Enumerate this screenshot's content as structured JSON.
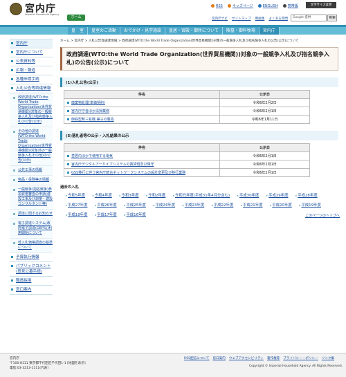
{
  "header": {
    "site_title": "宮内庁",
    "site_subtitle": "Imperial Household Agency",
    "home": "ホーム",
    "top_links": [
      "RSS",
      "キッズページ",
      "ENGLISH",
      "携帯版"
    ],
    "size_button": "文字サイズ変更",
    "sub_links": [
      "宮内庁ナビ",
      "サイトマップ",
      "用語集",
      "よくある質問"
    ],
    "search_placeholder": "Google 提供",
    "search_button": "検索"
  },
  "gnav": [
    "皇　室",
    "皇室のご活動",
    "おでかけ・見学施設",
    "皇居・宮殿・御所について",
    "陵墓・御料牧場",
    "宮内庁"
  ],
  "sidebar": {
    "items": [
      "宮内庁",
      "宮内庁について",
      "公表資料等",
      "広報・報道",
      "各種申請手続",
      "入札公告等調達情報"
    ],
    "sub": [
      "政府調達(WTO:the World Trade Organization(世界貿易機関))対象の一般競争入札及び指名競争入札の公告(公示)",
      "その他の調達(WTO:the World Trade Organization(世界貿易機関))対象外の一般競争入札その他)の公告(公示)"
    ],
    "items2": [
      "公共工事の情報",
      "物品・役務等の情報",
      "一般競争(指名競争)参加資格審査の申請(建設工事及び測量・建設コンサルタント等)",
      "調達に関するお知らせ",
      "電子調達システム(政府電子調達(GEPS))利用開始について",
      "低入札価格調査の基準について"
    ],
    "items3": [
      "予算執行情報",
      "パブリックコメント(意見公募手続)",
      "職員採用",
      "窓口案内"
    ]
  },
  "breadcrumb": "ホーム > 宮内庁 > 入札公告等調達情報 > 政府調達(WTO:the World Trade Organization(世界貿易機関))対象の一般競争入札及び指名競争入札の公告(公示)について",
  "page_title": "政府調達(WTO:the World Trade Organization(世界貿易機関))対象の一般競争入札及び指名競争入札)の公告(公示)について",
  "section1": {
    "title": "(1)入札公告(公示)",
    "col1": "件名",
    "col2": "公示日",
    "rows": [
      {
        "name": "廃棄物処理(単価契約)",
        "date": "令和6年2月2日"
      },
      {
        "name": "宮内庁庁舎ほか清掃業務",
        "date": "令和6年2月1日"
      },
      {
        "name": "御鉄型和三鉱機 兼子の製造",
        "date": "令和6年1月11日"
      }
    ]
  },
  "section2": {
    "title": "(5)落札者等の公示・入札結果の公示",
    "col1": "件名",
    "col2": "公示日",
    "rows": [
      {
        "name": "皇居内ほかで使用する電気",
        "date": "令和6年2月1日"
      },
      {
        "name": "宮内庁デジタルアーカイブシステムの賃貸借及び保守",
        "date": "令和6年2月1日"
      },
      {
        "name": "GSS移行に伴う宮内庁統合ネットワークシステムの設計変更及び移行業務",
        "date": "令和6年2月1日"
      }
    ]
  },
  "past": {
    "title": "過去の入札",
    "years": [
      "令和5年度",
      "令和4年度",
      "令和3年度",
      "令和2年度",
      "令和元年度(平成31年4月分含む)",
      "平成30年度",
      "平成29年度",
      "平成28年度",
      "平成27年度",
      "平成26年度",
      "平成25年度",
      "平成24年度",
      "平成23年度",
      "平成22年度",
      "平成21年度",
      "平成20年度",
      "平成19年度",
      "平成18年度",
      "平成17年度",
      "平成16年度"
    ]
  },
  "pagetop": "このページのトップへ",
  "footer": {
    "address": [
      "宮内庁",
      "〒100-8111 東京都千代田区千代田1-1 [地図を表示]",
      "電話:03-3213-1111(代表)"
    ],
    "links": [
      "RSS配信について",
      "窓口案内",
      "ウェブアクセシビリティ",
      "著作権等",
      "プライバシー・ポリシー",
      "リンク集"
    ],
    "copyright": "Copyright © Imperial Household Agency. All Rights Reserved."
  }
}
